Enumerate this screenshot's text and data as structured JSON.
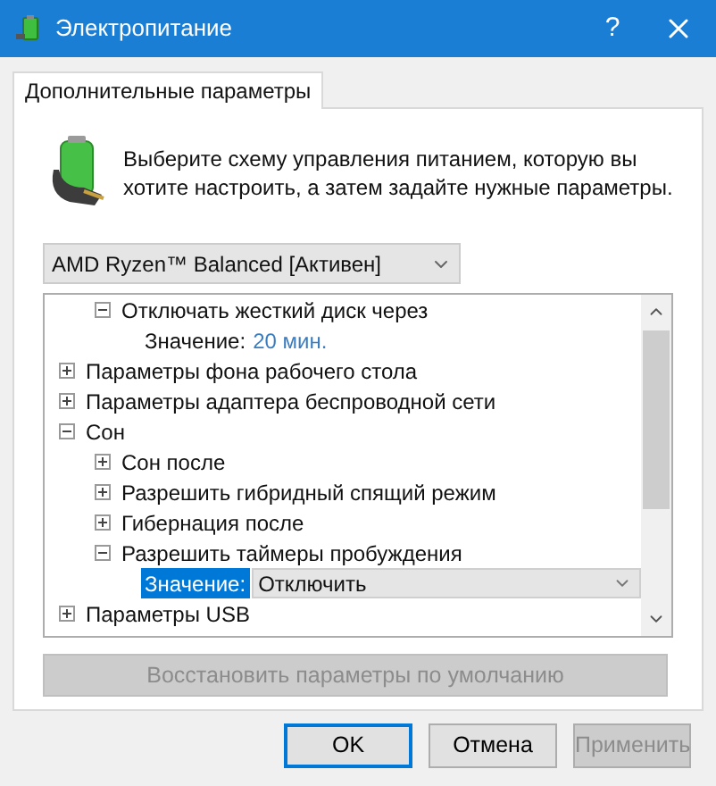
{
  "window": {
    "title": "Электропитание",
    "help_button": "?"
  },
  "tabs": [
    {
      "label": "Дополнительные параметры",
      "selected": true
    }
  ],
  "description": "Выберите схему управления питанием, которую вы хотите настроить, а затем задайте нужные параметры.",
  "plan_select": {
    "value": "AMD Ryzen™ Balanced [Активен]"
  },
  "tree": {
    "items": [
      {
        "kind": "hidden-parent",
        "children": [
          {
            "kind": "node",
            "label": "Отключать жесткий диск через",
            "expanded": true,
            "children": [
              {
                "kind": "value",
                "label": "Значение:",
                "value": "20 мин."
              }
            ]
          }
        ]
      },
      {
        "kind": "node",
        "label": "Параметры фона рабочего стола",
        "expanded": false
      },
      {
        "kind": "node",
        "label": "Параметры адаптера беспроводной сети",
        "expanded": false
      },
      {
        "kind": "node",
        "label": "Сон",
        "expanded": true,
        "children": [
          {
            "kind": "node",
            "label": "Сон после",
            "expanded": false
          },
          {
            "kind": "node",
            "label": "Разрешить гибридный спящий режим",
            "expanded": false
          },
          {
            "kind": "node",
            "label": "Гибернация после",
            "expanded": false
          },
          {
            "kind": "node",
            "label": "Разрешить таймеры пробуждения",
            "expanded": true,
            "children": [
              {
                "kind": "value-select",
                "label": "Значение:",
                "value": "Отключить",
                "selected": true
              }
            ]
          }
        ]
      },
      {
        "kind": "node",
        "label": "Параметры USB",
        "expanded": false
      }
    ]
  },
  "restore_button": {
    "label": "Восстановить параметры по умолчанию",
    "disabled": true
  },
  "buttons": [
    {
      "label": "OK",
      "default": true,
      "disabled": false
    },
    {
      "label": "Отмена",
      "default": false,
      "disabled": false
    },
    {
      "label": "Применить",
      "default": false,
      "disabled": true
    }
  ]
}
